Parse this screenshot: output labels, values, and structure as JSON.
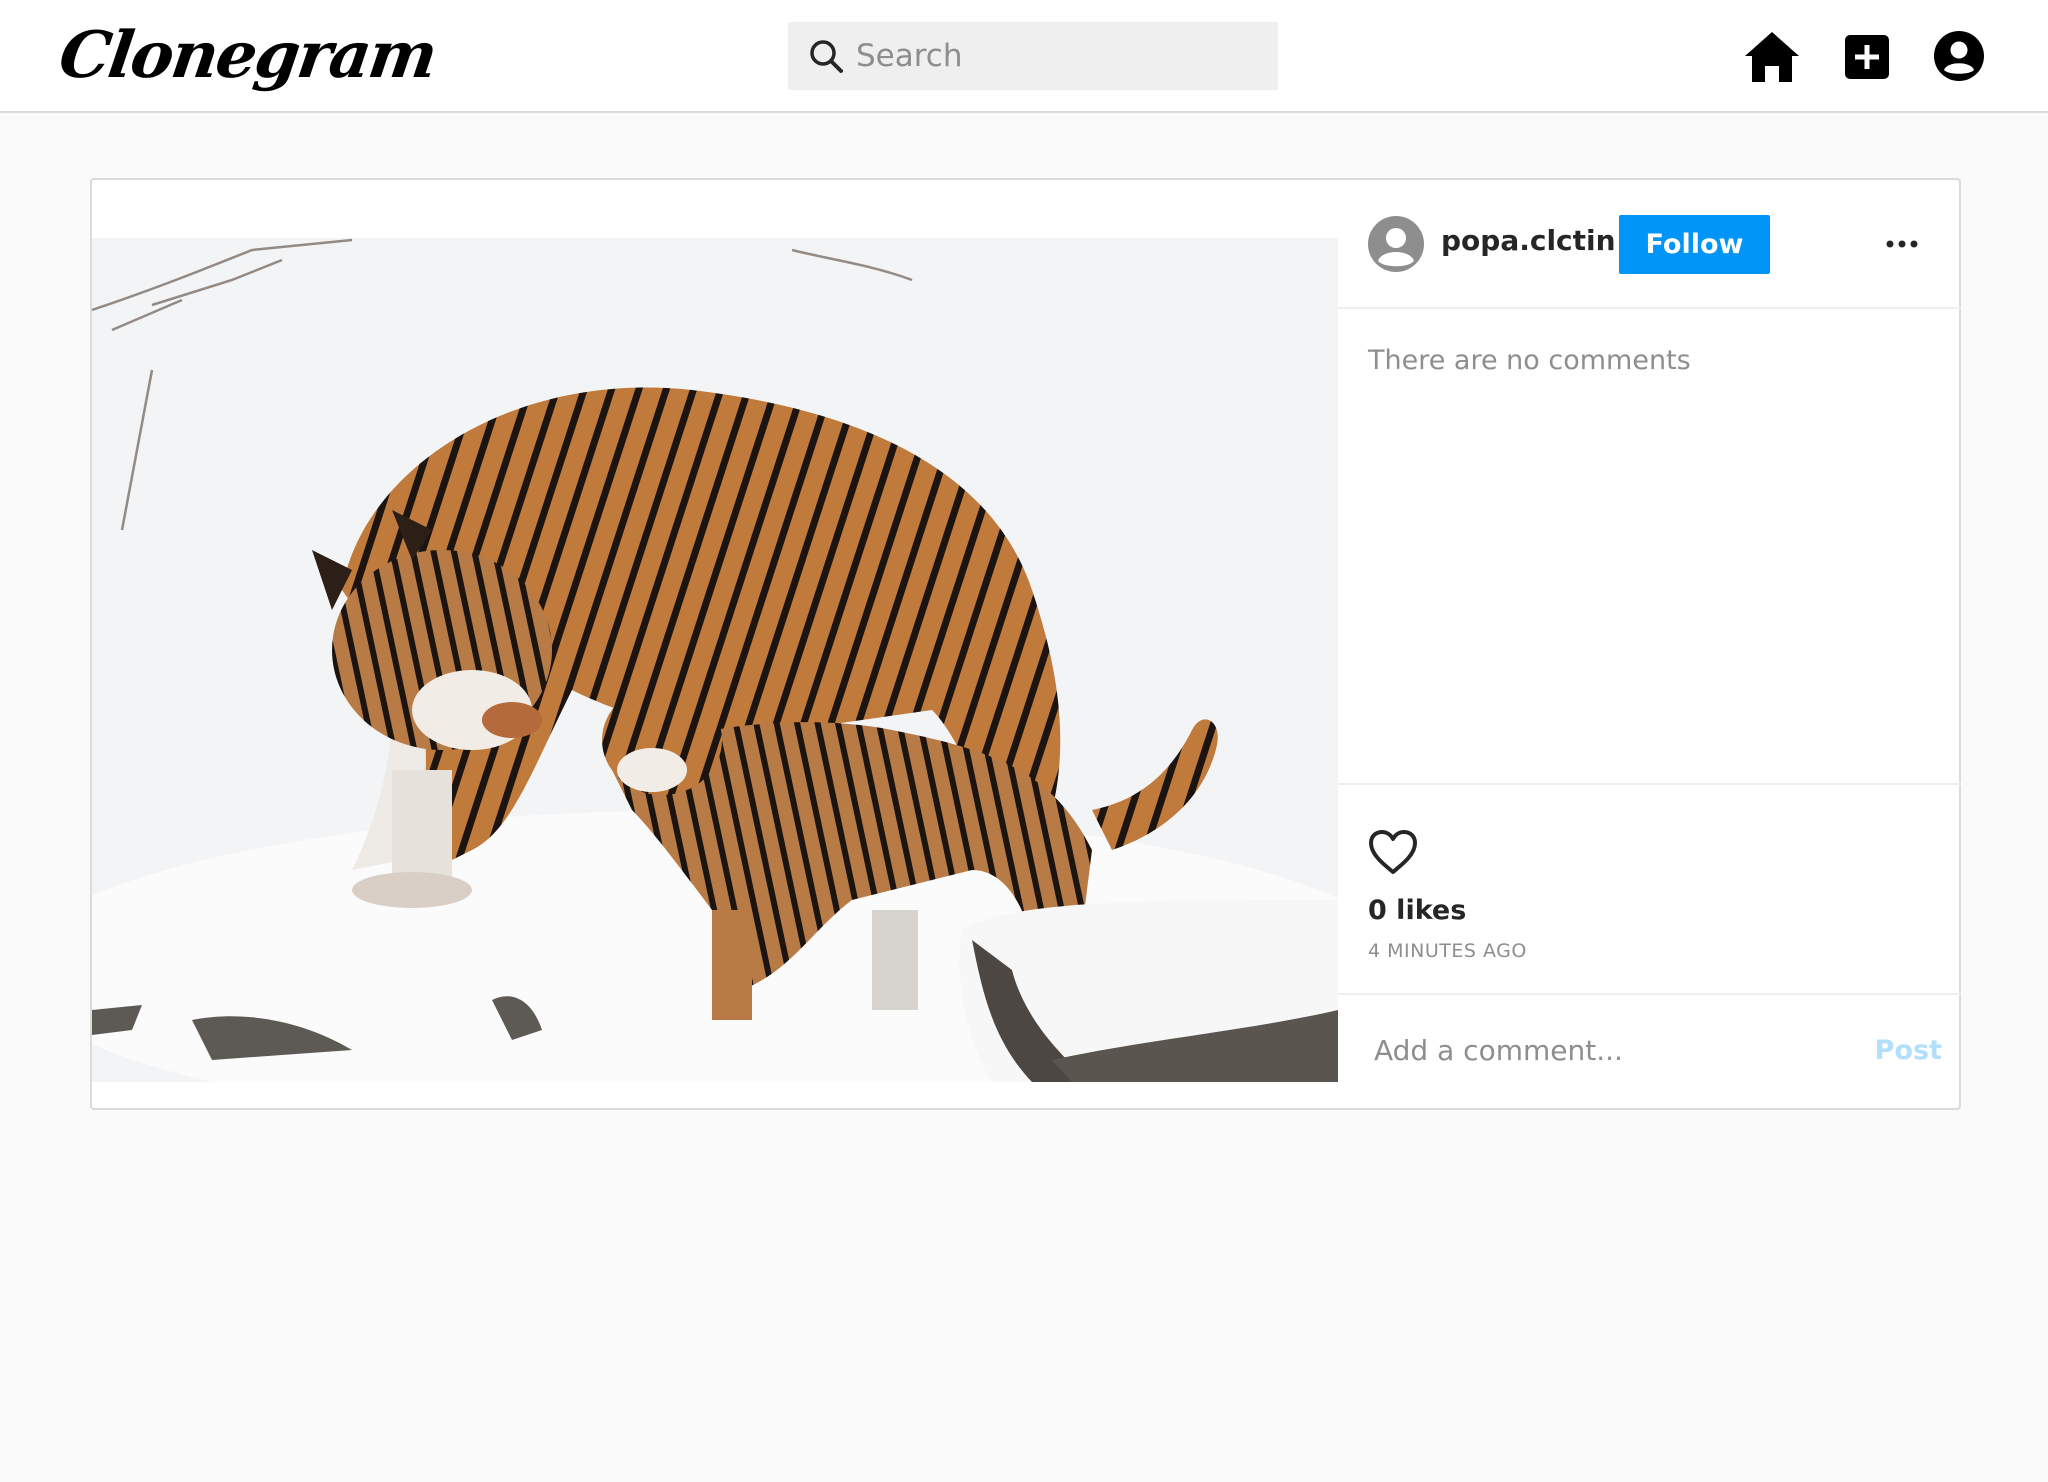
{
  "header": {
    "logo_text": "Clonegram",
    "search_placeholder": "Search",
    "icons": [
      "home-icon",
      "add-post-icon",
      "profile-icon"
    ]
  },
  "post": {
    "image_description_icon": "photo",
    "author": {
      "username": "popa.clctin",
      "avatar_icon": "default-avatar-icon"
    },
    "follow_label": "Follow",
    "more_icon": "more-options-icon",
    "no_comments_text": "There are no comments",
    "likes_text": "0 likes",
    "timestamp": "4 MINUTES AGO",
    "comment_placeholder": "Add a comment...",
    "post_label": "Post"
  },
  "colors": {
    "accent": "#0095f6",
    "post_disabled": "#b2dffc",
    "muted": "#8e8e8e",
    "border": "#dbdbdb",
    "background": "#fafafa"
  }
}
